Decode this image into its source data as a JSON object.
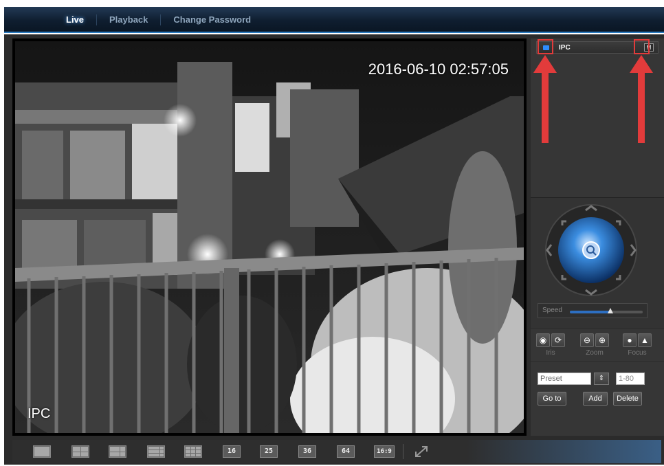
{
  "nav": {
    "items": [
      {
        "label": "Live",
        "active": true
      },
      {
        "label": "Playback",
        "active": false
      },
      {
        "label": "Change Password",
        "active": false
      }
    ]
  },
  "video": {
    "timestamp": "2016-06-10 02:57:05",
    "channel_name": "IPC"
  },
  "camera_list": {
    "items": [
      {
        "label": "IPC",
        "status_icon": "live-status-icon",
        "status_color": "#2e8cff",
        "mode_badge": "M"
      }
    ]
  },
  "ptz": {
    "speed_label": "Speed",
    "speed_level_fraction": 0.56,
    "lens": {
      "iris_label": "Iris",
      "zoom_label": "Zoom",
      "focus_label": "Focus"
    },
    "preset": {
      "selected": "Preset",
      "range_placeholder": "1-80",
      "goto_label": "Go to",
      "add_label": "Add",
      "delete_label": "Delete"
    }
  },
  "toolbar": {
    "layouts": [
      "1",
      "4",
      "6",
      "8",
      "9",
      "16",
      "25",
      "36",
      "64",
      "16:9"
    ],
    "fullscreen_icon": "fullscreen-icon"
  },
  "colors": {
    "accent": "#2a7bc0",
    "annotation": "#e23b3b"
  }
}
